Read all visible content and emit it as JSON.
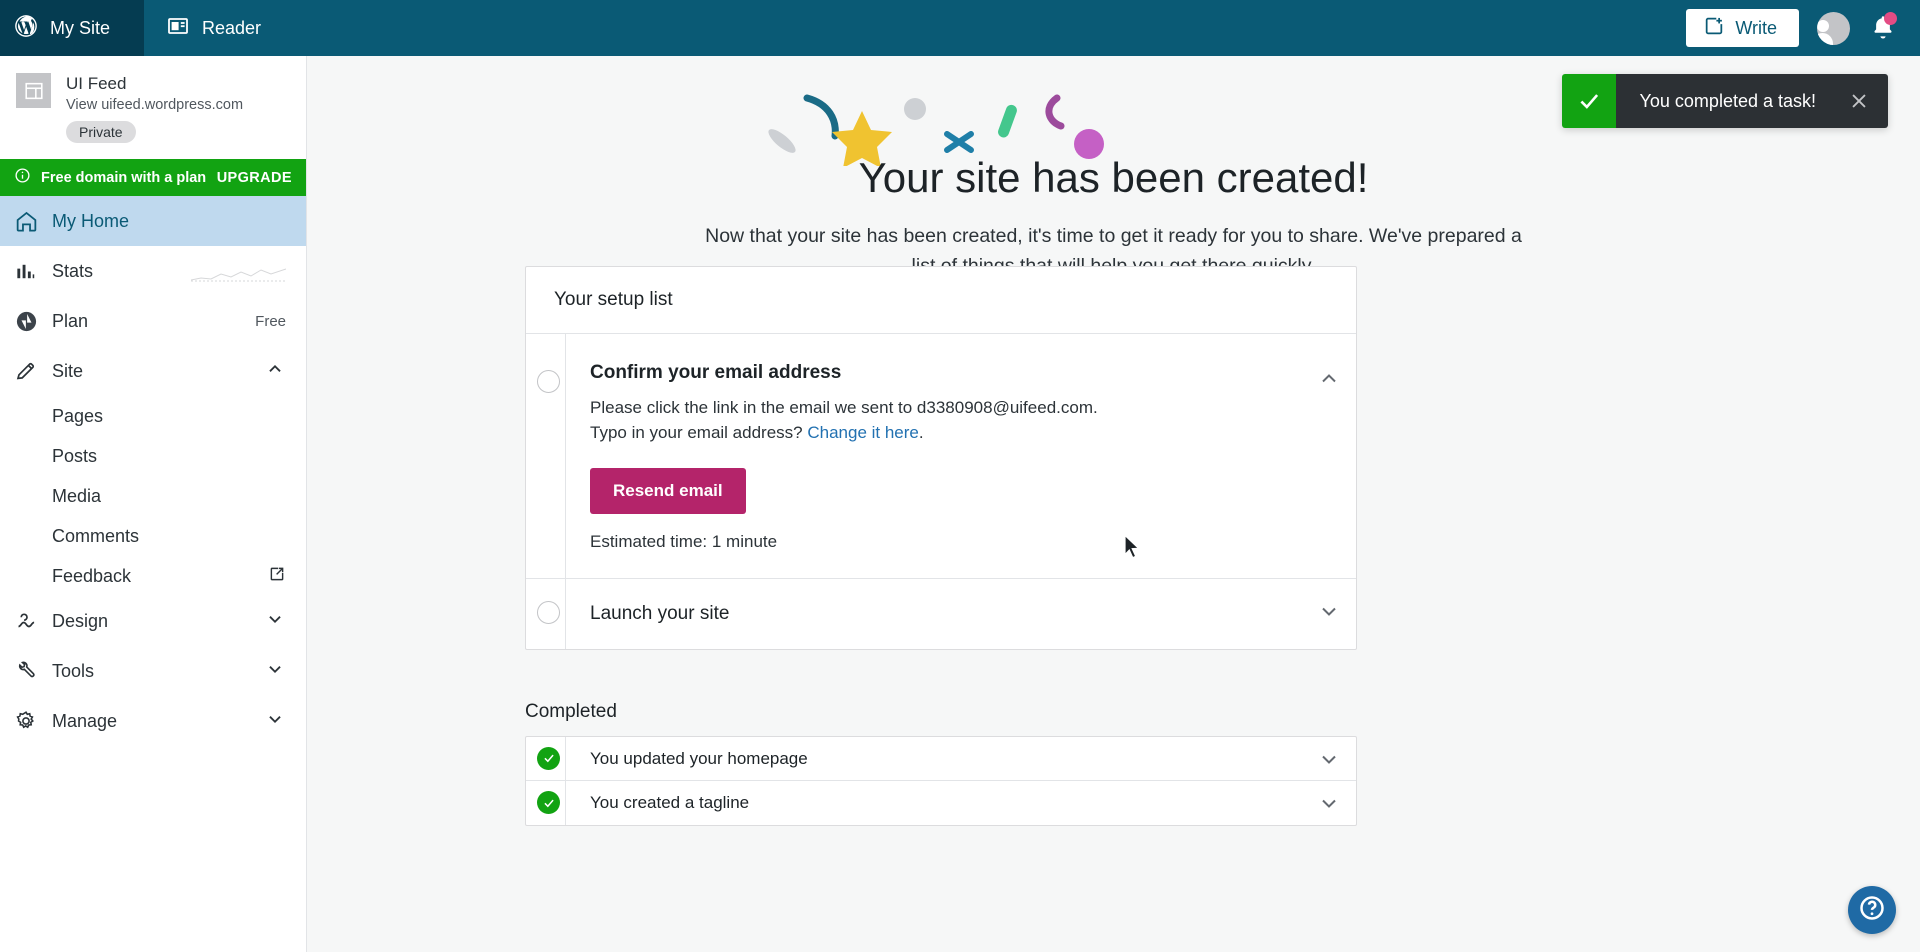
{
  "masterbar": {
    "my_site_label": "My Site",
    "reader_label": "Reader",
    "write_label": "Write",
    "wordpress_icon": "wordpress-logo-icon",
    "reader_icon": "reader-icon",
    "write_icon": "write-plus-icon",
    "avatar_icon": "user-avatar-icon",
    "bell_icon": "notifications-bell-icon"
  },
  "sidebar": {
    "site": {
      "name": "UI Feed",
      "url": "View uifeed.wordpress.com",
      "visibility_badge": "Private",
      "thumb_icon": "site-layout-icon"
    },
    "upgrade_banner": {
      "icon": "info-circle-icon",
      "label": "Free domain with a plan",
      "action": "UPGRADE",
      "color": "#12a312"
    },
    "items": [
      {
        "label": "My Home",
        "icon": "home-icon",
        "selected": true
      },
      {
        "label": "Stats",
        "icon": "stats-bars-icon",
        "sparkline": true
      },
      {
        "label": "Plan",
        "icon": "plan-jetpack-icon",
        "value": "Free"
      },
      {
        "label": "Site",
        "icon": "pencil-icon",
        "chevron": "chevron-up-icon",
        "expanded": true
      }
    ],
    "site_children": [
      {
        "label": "Pages"
      },
      {
        "label": "Posts"
      },
      {
        "label": "Media"
      },
      {
        "label": "Comments"
      },
      {
        "label": "Feedback",
        "icon_right": "external-link-icon"
      }
    ],
    "items_bottom": [
      {
        "label": "Design",
        "icon": "design-brush-icon",
        "chevron": "chevron-down-icon"
      },
      {
        "label": "Tools",
        "icon": "wrench-icon",
        "chevron": "chevron-down-icon"
      },
      {
        "label": "Manage",
        "icon": "gear-icon",
        "chevron": "chevron-down-icon"
      }
    ]
  },
  "main": {
    "hero_title": "Your site has been created!",
    "hero_subtitle": "Now that your site has been created, it's time to get it ready for you to share. We've prepared a list of things that will help you get there quickly.",
    "setup_card_title": "Your setup list",
    "tasks": [
      {
        "title": "Confirm your email address",
        "desc_line1": "Please click the link in the email we sent to d3380908@uifeed.com.",
        "desc_line2_pre": "Typo in your email address? ",
        "desc_link": "Change it here",
        "desc_line2_post": ".",
        "button_label": "Resend email",
        "estimated_time": "Estimated time: 1 minute",
        "chevron": "chevron-up-icon",
        "expanded": true,
        "status_icon": "empty-circle-icon"
      },
      {
        "title": "Launch your site",
        "chevron": "chevron-down-icon",
        "expanded": false,
        "status_icon": "empty-circle-icon"
      }
    ],
    "completed_label": "Completed",
    "completed": [
      {
        "label": "You updated your homepage",
        "chevron": "chevron-down-icon",
        "status_icon": "check-circle-icon"
      },
      {
        "label": "You created a tagline",
        "chevron": "chevron-down-icon",
        "status_icon": "check-circle-icon"
      }
    ]
  },
  "toast": {
    "message": "You completed a task!",
    "icon": "checkmark-icon",
    "close_icon": "close-x-icon",
    "accent_color": "#12a312"
  },
  "help_button": {
    "icon": "help-question-icon",
    "color": "#1f6aa5"
  },
  "theme": {
    "masterbar_bg": "#0a5a75",
    "primary_button": "#b4246a",
    "link": "#2271b1",
    "selected_nav": "#bfd9ee"
  }
}
